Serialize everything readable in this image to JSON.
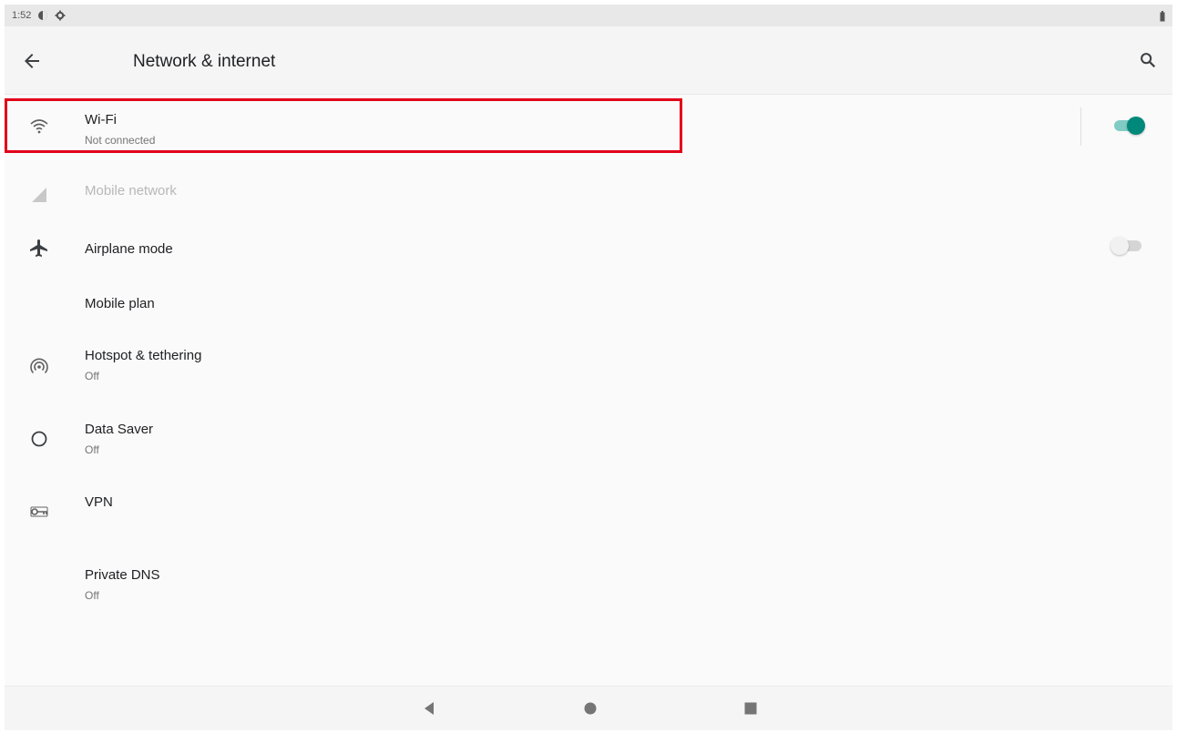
{
  "status_bar": {
    "time": "1:52",
    "icons": [
      "data-saver-status-icon",
      "settings-status-icon",
      "battery-icon"
    ]
  },
  "app_bar": {
    "title": "Network & internet",
    "back_icon": "arrow-back-icon",
    "search_icon": "search-icon"
  },
  "items": [
    {
      "icon": "wifi-icon",
      "title": "Wi-Fi",
      "subtitle": "Not connected",
      "toggle": "on"
    },
    {
      "icon": "signal-icon",
      "title": "Mobile network",
      "disabled": true
    },
    {
      "icon": "airplane-icon",
      "title": "Airplane mode",
      "toggle": "off"
    },
    {
      "icon": "",
      "title": "Mobile plan"
    },
    {
      "icon": "hotspot-icon",
      "title": "Hotspot & tethering",
      "subtitle": "Off"
    },
    {
      "icon": "data-saver-icon",
      "title": "Data Saver",
      "subtitle": "Off"
    },
    {
      "icon": "vpn-icon",
      "title": "VPN"
    },
    {
      "icon": "",
      "title": "Private DNS",
      "subtitle": "Off"
    }
  ],
  "nav_bar": {
    "icons": [
      "nav-back-icon",
      "nav-home-icon",
      "nav-recents-icon"
    ]
  },
  "colors": {
    "accent": "#00897b",
    "accent_light": "#80cbc4",
    "highlight": "#e2001a",
    "background": "#fafafa"
  }
}
